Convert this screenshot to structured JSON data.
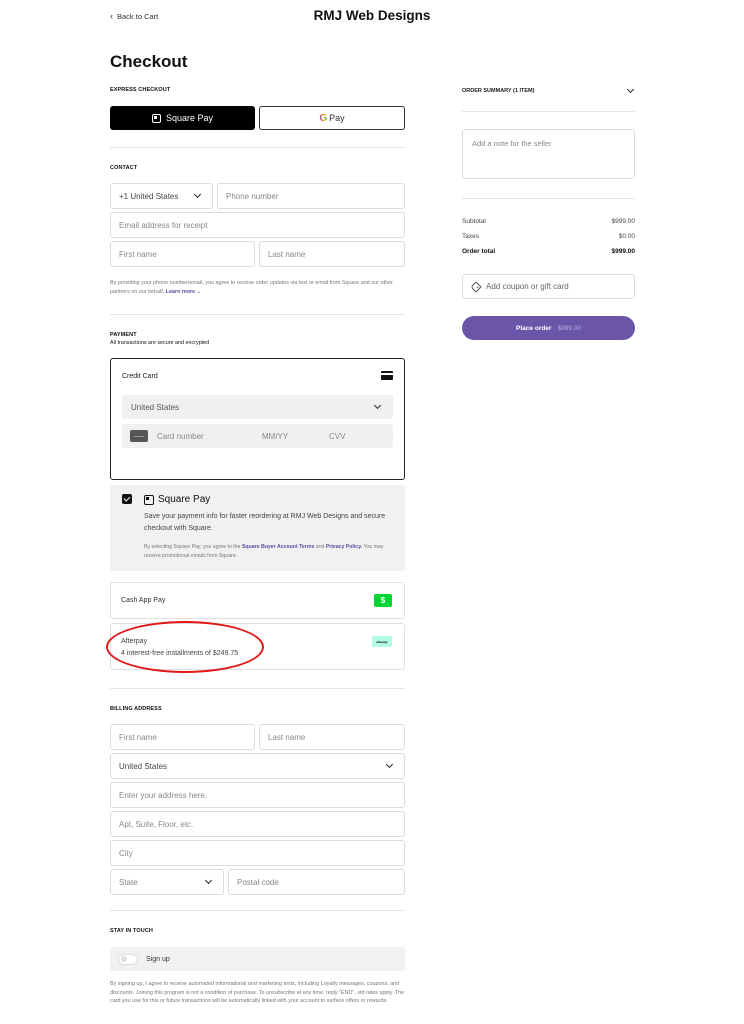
{
  "header": {
    "back_label": "Back to Cart",
    "store_name": "RMJ Web Designs"
  },
  "page_title": "Checkout",
  "express": {
    "section_label": "EXPRESS CHECKOUT",
    "square_pay_label": "Square Pay",
    "google_pay_g": "G",
    "google_pay_label": "Pay"
  },
  "contact": {
    "section_label": "CONTACT",
    "country_code": "+1 United States",
    "phone_placeholder": "Phone number",
    "email_placeholder": "Email address for receipt",
    "first_name_placeholder": "First name",
    "last_name_placeholder": "Last name",
    "consent_text": "By providing your phone number/email, you agree to receive order updates via text or email from Square and our other partners on our behalf.",
    "learn_more": "Learn more"
  },
  "payment": {
    "section_label": "PAYMENT",
    "subtitle": "All transactions are secure and encrypted",
    "credit_card": {
      "label": "Credit Card",
      "country": "United States",
      "card_number_placeholder": "Card number",
      "expiry_placeholder": "MM/YY",
      "cvv_placeholder": "CVV"
    },
    "square_pay": {
      "checked": true,
      "title": "Square Pay",
      "description": "Save your payment info for faster reordering at RMJ Web Designs and secure checkout with Square.",
      "legal_prefix": "By selecting Square Pay, you agree to the",
      "terms_link": "Square Buyer Account Terms",
      "and": "and",
      "privacy_link": "Privacy Policy.",
      "legal_suffix": "You may receive promotional emails from Square."
    },
    "cash_app": {
      "label": "Cash App Pay",
      "icon_glyph": "$"
    },
    "afterpay": {
      "label": "Afterpay",
      "installments": "4 interest-free installments of $249.75",
      "icon_text": "afterpay"
    }
  },
  "billing": {
    "section_label": "BILLING ADDRESS",
    "first_name_placeholder": "First name",
    "last_name_placeholder": "Last name",
    "country": "United States",
    "address_placeholder": "Enter your address here.",
    "apt_placeholder": "Apt, Suite, Floor, etc.",
    "city_placeholder": "City",
    "state_placeholder": "State",
    "postal_placeholder": "Postal code"
  },
  "stay_in_touch": {
    "section_label": "STAY IN TOUCH",
    "toggle_label": "Sign up",
    "toggle_on": false,
    "disclaimer": "By signing up, I agree to receive automated informational and marketing texts, including Loyalty messages, coupons, and discounts. Joining this program is not a condition of purchase. To unsubscribe at any time, reply \"END\", std rates apply. The card you use for this or future transactions will be automatically linked with your account to surface offers or rewards."
  },
  "order_summary": {
    "header_label": "ORDER SUMMARY (1 ITEM)",
    "note_placeholder": "Add a note for the seller",
    "subtotal_label": "Subtotal",
    "subtotal_value": "$999.00",
    "taxes_label": "Taxes",
    "taxes_value": "$0.00",
    "total_label": "Order total",
    "total_value": "$999.00",
    "coupon_label": "Add coupon or gift card",
    "place_order_label": "Place order",
    "place_order_amount": "$999.00",
    "accent_color": "#6b55a8"
  },
  "annotation": {
    "highlight_color": "#e01818",
    "highlight_target": "afterpay"
  }
}
